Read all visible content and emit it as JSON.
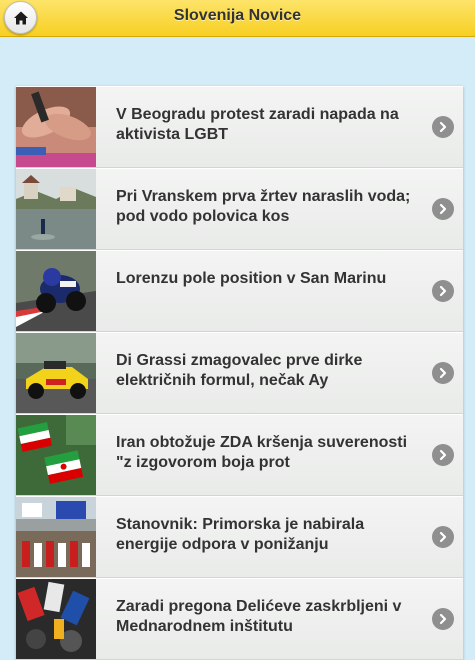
{
  "header": {
    "title": "Slovenija Novice",
    "home_icon": "home-icon"
  },
  "news": [
    {
      "title": "V Beogradu protest zaradi napada na aktivista LGBT",
      "image": "holding-hands-photo"
    },
    {
      "title": "Pri Vranskem prva žrtev naraslih voda; pod vodo polovica kos",
      "image": "flooded-village-photo"
    },
    {
      "title": "Lorenzu pole position v San Marinu",
      "image": "motorcycle-race-photo"
    },
    {
      "title": "Di Grassi zmagovalec prve dirke električnih formul, nečak Ay",
      "image": "formula-e-car-photo"
    },
    {
      "title": "Iran obtožuje ZDA kršenja suverenosti \"z izgovorom boja prot",
      "image": "iranian-flags-photo"
    },
    {
      "title": "Stanovnik: Primorska je nabirala energije odpora v ponižanju",
      "image": "parade-crowd-photo"
    },
    {
      "title": "Zaradi pregona Delićeve zaskrbljeni v Mednarodnem inštitutu",
      "image": "microphones-photo"
    }
  ],
  "colors": {
    "header": "#f9d434",
    "background": "#d3ecf8",
    "row": "#eef0ee",
    "arrow": "#8f8f8f"
  }
}
